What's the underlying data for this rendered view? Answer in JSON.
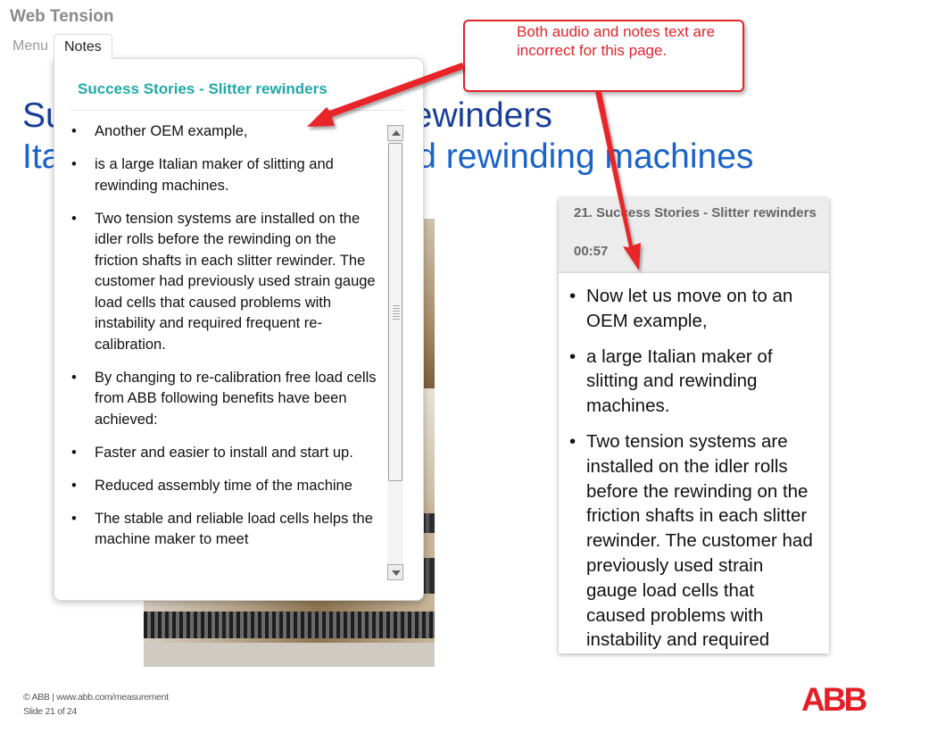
{
  "app": {
    "title": "Web Tension"
  },
  "tabs": [
    {
      "label": "Menu",
      "active": false
    },
    {
      "label": "Notes",
      "active": true
    }
  ],
  "slide": {
    "title_line1": "Success Stories - Slitter rewinders",
    "title_line2": "Italian maker of slitting and rewinding machines",
    "image": "machine-photo"
  },
  "notes": {
    "heading": "Success Stories - Slitter rewinders",
    "items": [
      "Another  OEM example,",
      "is a large Italian maker of slitting and rewinding machines.",
      "Two tension systems are installed on the idler rolls before the rewinding on the friction shafts in each slitter rewinder. The customer had previously used strain gauge load cells that caused problems with instability and required frequent re-calibration.",
      "By changing to re-calibration free load cells from ABB following benefits have been achieved:",
      "Faster and easier to install and start up.",
      "Reduced assembly time of the machine",
      "The stable and reliable load cells helps the machine maker to meet"
    ]
  },
  "audio": {
    "title": "21. Success Stories - Slitter rewinders",
    "time": "00:57",
    "items": [
      "Now let us move on to an OEM example,",
      "a large Italian maker of slitting and rewinding machines.",
      "Two tension systems are installed on the idler rolls before the rewinding on the friction shafts in each slitter rewinder. The customer had previously used strain gauge load cells that caused problems with instability and required"
    ]
  },
  "callout": {
    "text": "Both audio and notes text are incorrect for this page.",
    "color": "#e0252b"
  },
  "footer": {
    "copyright": "© ABB | www.abb.com/measurement",
    "slide_counter": "Slide 21 of 24",
    "logo": "ABB"
  },
  "colors": {
    "accent_teal": "#22a8a8",
    "title_blue": "#1a3f9a",
    "subtitle_blue": "#1a63c9",
    "brand_red": "#e41e26"
  },
  "icons": [
    "scroll-up-arrow-icon",
    "scroll-down-arrow-icon",
    "annotation-arrow-icon"
  ]
}
